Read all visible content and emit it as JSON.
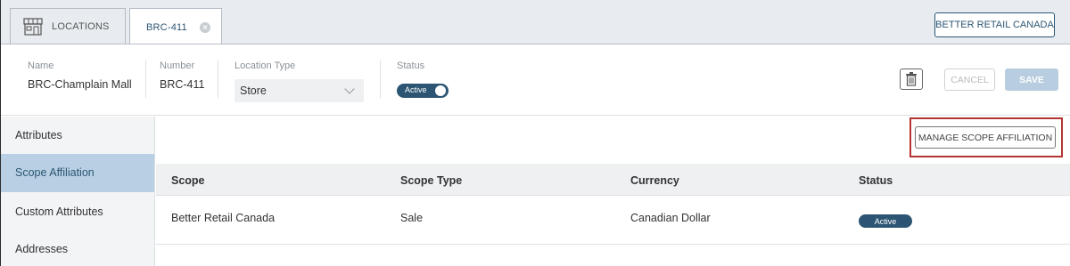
{
  "tabs": {
    "locations_label": "LOCATIONS",
    "active_label": "BRC-411",
    "brand_button": "BETTER RETAIL CANADA"
  },
  "record": {
    "name_label": "Name",
    "name_value": "BRC-Champlain Mall",
    "number_label": "Number",
    "number_value": "BRC-411",
    "type_label": "Location Type",
    "type_value": "Store",
    "status_label": "Status",
    "status_value": "Active"
  },
  "actions": {
    "cancel": "CANCEL",
    "save": "SAVE"
  },
  "sidebar": {
    "items": [
      {
        "label": "Attributes"
      },
      {
        "label": "Scope Affiliation"
      },
      {
        "label": "Custom Attributes"
      },
      {
        "label": "Addresses"
      }
    ]
  },
  "main": {
    "manage_button": "MANAGE SCOPE AFFILIATION",
    "columns": [
      "Scope",
      "Scope Type",
      "Currency",
      "Status"
    ],
    "rows": [
      {
        "scope": "Better Retail Canada",
        "scope_type": "Sale",
        "currency": "Canadian Dollar",
        "status": "Active"
      }
    ]
  },
  "colors": {
    "accent": "#2b5573",
    "active_nav": "#b9d0e4",
    "highlight_border": "#b53333"
  }
}
